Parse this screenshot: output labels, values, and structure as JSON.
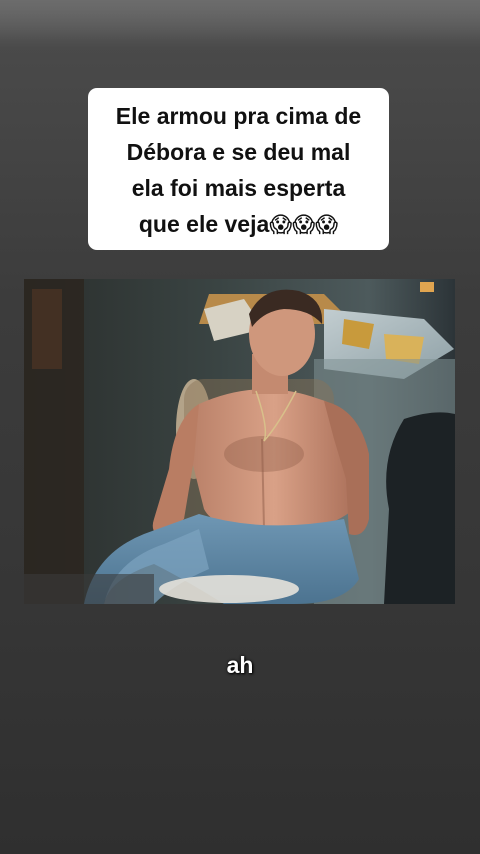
{
  "caption": {
    "lines": [
      "Ele armou pra cima de",
      "Débora e se deu mal",
      "ela foi mais esperta",
      "que ele veja"
    ],
    "emoji": "😱😱😱",
    "emoji_icon": "face-screaming-in-fear-icon"
  },
  "subtitle": "ah",
  "colors": {
    "background": "#3a3a3a",
    "caption_background": "#ffffff",
    "caption_text": "#111111",
    "subtitle_text": "#ffffff"
  }
}
